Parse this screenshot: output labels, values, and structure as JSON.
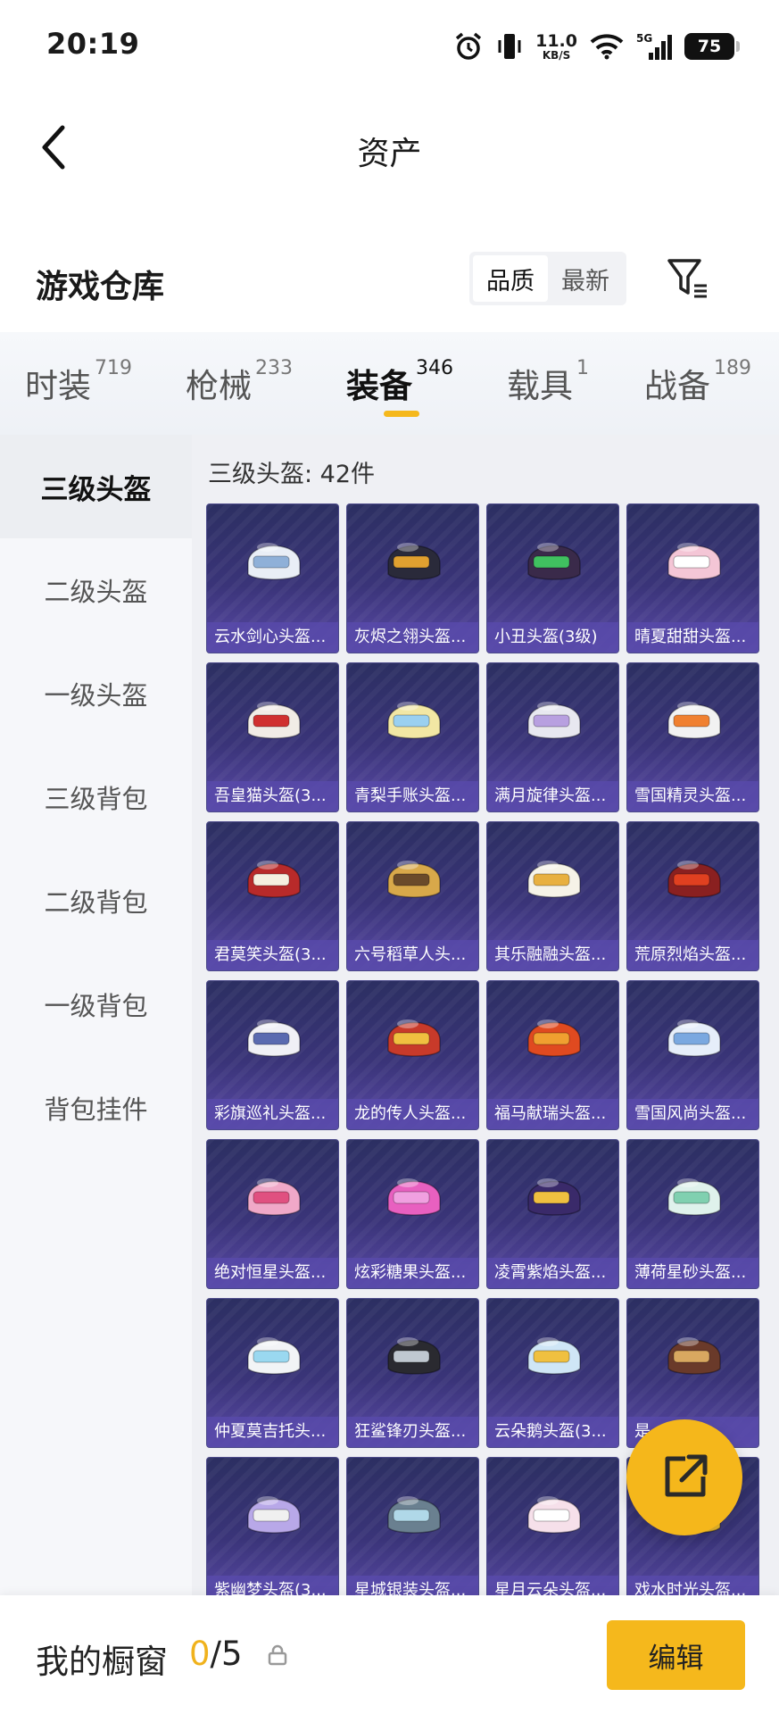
{
  "status": {
    "time": "20:19",
    "net_speed_value": "11.0",
    "net_speed_unit": "KB/S",
    "network": "5G",
    "battery": "75"
  },
  "nav": {
    "title": "资产"
  },
  "warehouse": {
    "title": "游戏仓库",
    "sort_options": [
      "品质",
      "最新"
    ],
    "active_sort": "品质"
  },
  "categories": [
    {
      "label": "时装",
      "count": "719"
    },
    {
      "label": "枪械",
      "count": "233"
    },
    {
      "label": "装备",
      "count": "346",
      "active": true
    },
    {
      "label": "载具",
      "count": "1"
    },
    {
      "label": "战备",
      "count": "189"
    }
  ],
  "side_menu": [
    "三级头盔",
    "二级头盔",
    "一级头盔",
    "三级背包",
    "二级背包",
    "一级背包",
    "背包挂件"
  ],
  "content": {
    "section_title": "三级头盔: 42件"
  },
  "items": [
    {
      "name": "云水剑心头盔...",
      "color": "#e9eef6",
      "accent": "#8fb0d8"
    },
    {
      "name": "灰烬之翎头盔...",
      "color": "#2a2a3a",
      "accent": "#e0a030"
    },
    {
      "name": "小丑头盔(3级)",
      "color": "#3a2a4a",
      "accent": "#40c060"
    },
    {
      "name": "晴夏甜甜头盔...",
      "color": "#f4c6d6",
      "accent": "#ffffff"
    },
    {
      "name": "吾皇猫头盔(3...",
      "color": "#f1ece6",
      "accent": "#d03030"
    },
    {
      "name": "青梨手账头盔...",
      "color": "#f2e7a4",
      "accent": "#9ad0f0"
    },
    {
      "name": "满月旋律头盔...",
      "color": "#e8e8f0",
      "accent": "#b8a0e0"
    },
    {
      "name": "雪国精灵头盔...",
      "color": "#f2f2f2",
      "accent": "#f08030"
    },
    {
      "name": "君莫笑头盔(3...",
      "color": "#b82a2a",
      "accent": "#f5f0e0"
    },
    {
      "name": "六号稻草人头...",
      "color": "#d8a84a",
      "accent": "#6a4a2a"
    },
    {
      "name": "其乐融融头盔...",
      "color": "#f6f3e8",
      "accent": "#e8b040"
    },
    {
      "name": "荒原烈焰头盔...",
      "color": "#8a2020",
      "accent": "#e04020"
    },
    {
      "name": "彩旗巡礼头盔...",
      "color": "#f0f0f6",
      "accent": "#5a6ab0"
    },
    {
      "name": "龙的传人头盔...",
      "color": "#c83a2a",
      "accent": "#f0c040"
    },
    {
      "name": "福马献瑞头盔...",
      "color": "#e04a20",
      "accent": "#f0a030"
    },
    {
      "name": "雪国风尚头盔...",
      "color": "#e6eefa",
      "accent": "#7aa8e0"
    },
    {
      "name": "绝对恒星头盔...",
      "color": "#f0a8c8",
      "accent": "#e05080"
    },
    {
      "name": "炫彩糖果头盔...",
      "color": "#e860c0",
      "accent": "#f0a0e0"
    },
    {
      "name": "凌霄紫焰头盔...",
      "color": "#3a2a6a",
      "accent": "#f0c040"
    },
    {
      "name": "薄荷星砂头盔...",
      "color": "#dff2ec",
      "accent": "#80d0b0"
    },
    {
      "name": "仲夏莫吉托头...",
      "color": "#f2f4f6",
      "accent": "#9ad8f0"
    },
    {
      "name": "狂鲨锋刃头盔...",
      "color": "#2a2a30",
      "accent": "#c0c8d0"
    },
    {
      "name": "云朵鹅头盔(3...",
      "color": "#cfe6f6",
      "accent": "#f0c040"
    },
    {
      "name": "是...头盔...",
      "color": "#6a3a2a",
      "accent": "#d8a860"
    },
    {
      "name": "紫幽梦头盔(3...",
      "color": "#b8a8e8",
      "accent": "#f0f0f0"
    },
    {
      "name": "星城银装头盔...",
      "color": "#6a8090",
      "accent": "#b0d8e8"
    },
    {
      "name": "星月云朵头盔...",
      "color": "#f6e0ea",
      "accent": "#ffffff"
    },
    {
      "name": "戏水时光头盔...",
      "color": "#f2c030",
      "accent": "#f8e080"
    }
  ],
  "bottom": {
    "shop_label": "我的橱窗",
    "shop_current": "0",
    "shop_total": "/5",
    "edit_label": "编辑"
  }
}
